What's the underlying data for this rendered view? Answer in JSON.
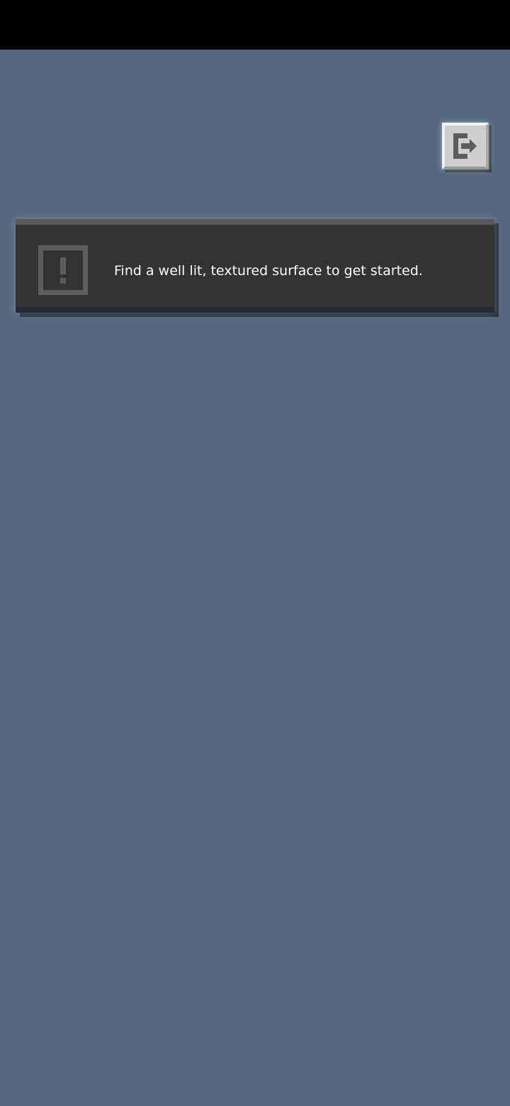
{
  "toast": {
    "message": "Find a well lit, textured surface to get started.",
    "icon": "warning-icon"
  },
  "exit_button": {
    "icon": "exit-icon"
  },
  "colors": {
    "background": "#56687f",
    "status_bar": "#000000",
    "toast_background": "#333333",
    "toast_text": "#ffffff",
    "button_face": "#cfcfcf",
    "icon_gray": "#5c5c5c"
  }
}
